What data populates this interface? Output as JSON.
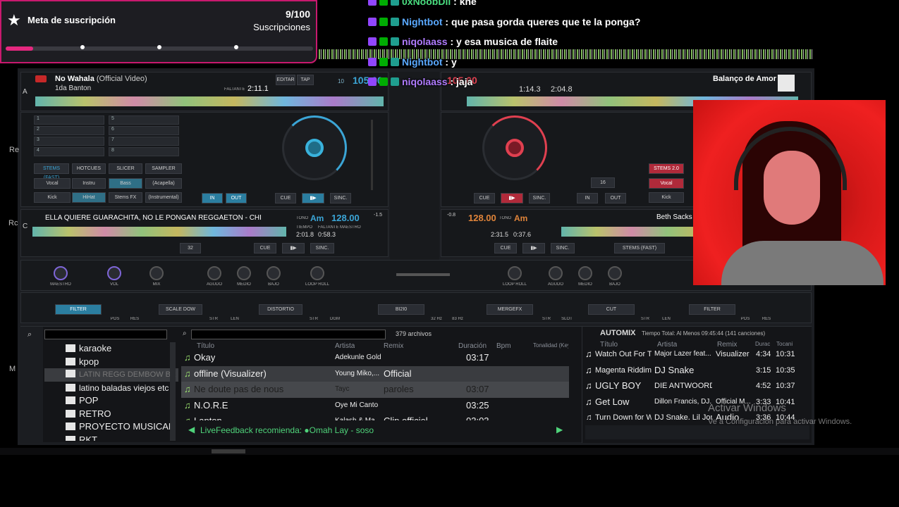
{
  "overlay": {
    "title": "Meta de suscripción",
    "count": "9/100",
    "unit": "Suscripciones",
    "progress": 0.09,
    "accent": "#e5287f"
  },
  "chat": [
    {
      "user": "0xNoobDil",
      "user_color": "#4ade80",
      "msg": "kne"
    },
    {
      "user": "Nightbot",
      "user_color": "#5aa9ff",
      "msg": "que pasa gorda queres que te la ponga?"
    },
    {
      "user": "niqolaass",
      "user_color": "#b07cff",
      "msg": "y esa musica de flaite"
    },
    {
      "user": "Nightbot",
      "user_color": "#5aa9ff",
      "msg": "y"
    },
    {
      "user": "niqolaass",
      "user_color": "#b07cff",
      "msg": "jaja"
    }
  ],
  "deckA": {
    "letter": "A",
    "title": "No Wahala",
    "title_suffix": "(Official Video)",
    "artist": "1da Banton",
    "remain_label": "FALTANTE",
    "remain": "2:11.1",
    "edit": "EDITAR",
    "tap": "TAP",
    "bpm": "105.00",
    "pitch": "10",
    "pads": [
      "1",
      "2",
      "3",
      "4",
      "5",
      "6",
      "7",
      "8"
    ],
    "stems_tabs": [
      "STEMS (FAST)",
      "HOTCUES",
      "SLICER",
      "SAMPLER"
    ],
    "stems": [
      "Vocal",
      "Instru",
      "Bass",
      "(Acapella)",
      "Kick",
      "HiHat",
      "Stems FX",
      "(Instrumental)"
    ],
    "cue": "CUE",
    "sync": "SINC.",
    "in": "IN",
    "out": "OUT"
  },
  "deckB": {
    "bpm": "105.00",
    "elapsed": "1:14.3",
    "remain": "2:04.8",
    "track": "Balanço de Amor",
    "cue": "CUE",
    "sync": "SINC.",
    "in": "IN",
    "out": "OUT",
    "loop": "16",
    "stems": [
      "STEMS 2.0",
      "Vocal",
      "Kick"
    ]
  },
  "deckC": {
    "letter": "C",
    "title": "ELLA QUIERE GUARACHITA, NO LE PONGAN REGGAETON - CHI",
    "tono": "TONO",
    "key": "Am",
    "bpm": "128.00",
    "tiempo_label": "TIEMPO",
    "faltante_label": "FALTANTE",
    "maestro": "MAESTRO",
    "elapsed": "2:01.8",
    "remain": "0:58.3",
    "pitch": "-1.5",
    "loop": "32",
    "cue": "CUE",
    "sync": "SINC."
  },
  "deckD": {
    "bpm": "128.00",
    "tono": "TONO",
    "key": "Am",
    "elapsed": "2:31.5",
    "remain": "0:37.6",
    "pitch": "-0.8",
    "track": "Beth Sacks",
    "cue": "CUE",
    "sync": "SINC.",
    "stems": "STEMS (FAST)"
  },
  "mixer": {
    "labels": [
      "MAESTRO",
      "VOL",
      "MIX",
      "AGUDO",
      "MEDIO",
      "BAJO",
      "LOOP ROLL",
      "LOOP ROLL",
      "AGUDO",
      "MEDIO",
      "BAJO"
    ],
    "gan": "GAN."
  },
  "fx": {
    "units": [
      "FILTER",
      "SCALE DOW",
      "DISTORTIO",
      "BI2I0",
      "MERGEFX",
      "CUT",
      "FILTER"
    ],
    "knobs": [
      "POS",
      "RES",
      "STR",
      "LEN",
      "STR",
      "DGM",
      "32 Hz",
      "83 Hz",
      "STR",
      "SLOT",
      "STR",
      "LEN",
      "POS",
      "RES"
    ]
  },
  "browser": {
    "folders": [
      "karaoke",
      "kpop",
      "LATIN REGG DEMBOW BR AF",
      "latino baladas viejos etc",
      "POP",
      "RETRO",
      "PROYECTO MUSICAL",
      "RKT"
    ],
    "files_count": "379 archivos",
    "columns": [
      "Título",
      "Artista",
      "Remix",
      "Duración",
      "Bpm",
      "Tonalidad (Key"
    ],
    "tracks": [
      {
        "title": "Okay",
        "artist": "Adekunle Gold",
        "remix": "",
        "duration": "03:17"
      },
      {
        "title": "offline (Visualizer)",
        "artist": "Young Miko,...",
        "remix": "Official",
        "duration": ""
      },
      {
        "title": "Ne doute pas de nous",
        "artist": "Tayc",
        "remix": "paroles",
        "duration": "03:07"
      },
      {
        "title": "N.O.R.E",
        "artist": "Oye Mi Canto",
        "remix": "",
        "duration": "03:25"
      },
      {
        "title": "Lapton",
        "artist": "Kalash & Ma...",
        "remix": "Clip officiel",
        "duration": "03:03"
      }
    ],
    "feedback": "LiveFeedback recomienda: ●Omah Lay - soso"
  },
  "automix": {
    "title": "AUTOMIX",
    "total": "Tiempo Total: Al Menos 09:45:44 (141 canciones)",
    "columns": [
      "Título",
      "Artista",
      "Remix",
      "Durac",
      "Tocani"
    ],
    "tracks": [
      {
        "title": "Watch Out For Th...",
        "artist": "Major Lazer feat...",
        "remix": "Visualizer",
        "dur": "4:34",
        "at": "10:31"
      },
      {
        "title": "Magenta Riddim",
        "artist": "DJ Snake",
        "remix": "",
        "dur": "3:15",
        "at": "10:35"
      },
      {
        "title": "UGLY BOY",
        "artist": "DIE ANTWOORD",
        "remix": "",
        "dur": "4:52",
        "at": "10:37"
      },
      {
        "title": "Get Low",
        "artist": "Dillon Francis, DJ...",
        "remix": "Official M...",
        "dur": "3:33",
        "at": "10:41"
      },
      {
        "title": "Turn Down for W...",
        "artist": "DJ Snake, Lil Jon",
        "remix": "Audio",
        "dur": "3:36",
        "at": "10:44"
      }
    ]
  },
  "watermark": {
    "line1": "Activar Windows",
    "line2": "Ve a Configuración para activar Windows."
  },
  "side_letters": [
    "Re",
    "Rc",
    "M"
  ]
}
